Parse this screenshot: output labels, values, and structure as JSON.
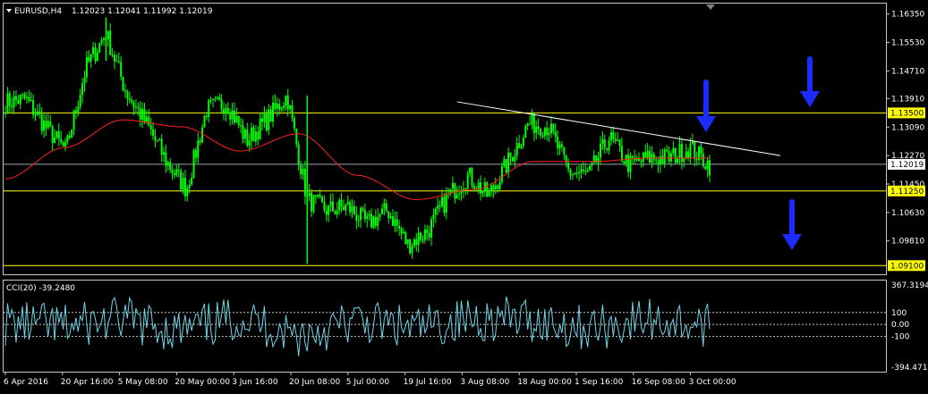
{
  "symbol": "EURUSD,H4",
  "ohlc": "1.12023 1.12041 1.11992 1.12019",
  "colors": {
    "background": "#000000",
    "candles": "#00ff00",
    "ma": "#ff2020",
    "level": "#ffff00",
    "trendline": "#ffffff",
    "cci": "#6fd3e6",
    "arrow": "#1a2cff",
    "grid_axis": "#c8c8c8"
  },
  "price_axis": {
    "ticks": [
      "1.16350",
      "1.15530",
      "1.14710",
      "1.13910",
      "1.13090",
      "1.12270",
      "1.11450",
      "1.10630",
      "1.09810"
    ],
    "levels": [
      {
        "label": "1.13500",
        "value": 1.135
      },
      {
        "label": "1.11250",
        "value": 1.1125
      },
      {
        "label": "1.09100",
        "value": 1.091
      }
    ],
    "current": {
      "label": "1.12019",
      "value": 1.12019
    }
  },
  "cci": {
    "title": "CCI(20) -39.2480",
    "top_label": "367.3194",
    "bottom_label": "-394.4714",
    "levels": [
      "100",
      "0.00",
      "-100"
    ]
  },
  "time_axis": [
    "6 Apr 2016",
    "20 Apr 16:00",
    "5 May 08:00",
    "20 May 00:00",
    "3 Jun 16:00",
    "20 Jun 08:00",
    "5 Jul 00:00",
    "19 Jul 16:00",
    "3 Aug 08:00",
    "18 Aug 00:00",
    "1 Sep 16:00",
    "16 Sep 08:00",
    "3 Oct 00:00"
  ],
  "arrows": [
    "down-arrow-1",
    "down-arrow-2",
    "down-arrow-3"
  ],
  "chart_data": {
    "type": "candlestick",
    "title": "EURUSD,H4",
    "series": [
      {
        "name": "EURUSD,H4",
        "x": [
          "6 Apr",
          "15 Apr",
          "20 Apr",
          "27 Apr",
          "3 May",
          "5 May",
          "9 May",
          "13 May",
          "20 May",
          "26 May",
          "3 Jun",
          "7 Jun",
          "13 Jun",
          "20 Jun",
          "23 Jun",
          "24 Jun",
          "30 Jun",
          "5 Jul",
          "8 Jul",
          "14 Jul",
          "19 Jul",
          "25 Jul",
          "29 Jul",
          "3 Aug",
          "9 Aug",
          "15 Aug",
          "18 Aug",
          "23 Aug",
          "26 Aug",
          "1 Sep",
          "6 Sep",
          "12 Sep",
          "16 Sep",
          "22 Sep",
          "28 Sep",
          "3 Oct"
        ],
        "close": [
          1.138,
          1.139,
          1.131,
          1.124,
          1.148,
          1.158,
          1.141,
          1.132,
          1.121,
          1.113,
          1.136,
          1.138,
          1.127,
          1.133,
          1.14,
          1.11,
          1.107,
          1.108,
          1.103,
          1.107,
          1.097,
          1.101,
          1.111,
          1.117,
          1.111,
          1.121,
          1.132,
          1.131,
          1.118,
          1.117,
          1.128,
          1.12,
          1.122,
          1.122,
          1.125,
          1.12
        ]
      },
      {
        "name": "MA",
        "x": [
          "6 Apr",
          "20 Apr",
          "5 May",
          "20 May",
          "3 Jun",
          "20 Jun",
          "5 Jul",
          "19 Jul",
          "3 Aug",
          "18 Aug",
          "1 Sep",
          "16 Sep",
          "3 Oct"
        ],
        "values": [
          1.116,
          1.125,
          1.133,
          1.131,
          1.124,
          1.129,
          1.117,
          1.11,
          1.113,
          1.121,
          1.121,
          1.122,
          1.122
        ]
      },
      {
        "name": "CCI(20)",
        "x": [
          "6 Apr",
          "20 Apr",
          "5 May",
          "20 May",
          "3 Jun",
          "20 Jun",
          "5 Jul",
          "19 Jul",
          "3 Aug",
          "18 Aug",
          "1 Sep",
          "16 Sep",
          "3 Oct"
        ],
        "values": [
          40,
          -60,
          150,
          -200,
          200,
          -300,
          80,
          -120,
          180,
          120,
          -100,
          150,
          -39.248
        ]
      }
    ],
    "trendline": {
      "from": {
        "x": "29 Jul",
        "y": 1.1382
      },
      "to": {
        "x": "10 Oct",
        "y": 1.1227
      }
    },
    "horizontal_levels": [
      1.135,
      1.1125,
      1.091
    ],
    "ylim": [
      1.0885,
      1.1665
    ],
    "cci_ylim": [
      -394.4714,
      367.3194
    ]
  }
}
